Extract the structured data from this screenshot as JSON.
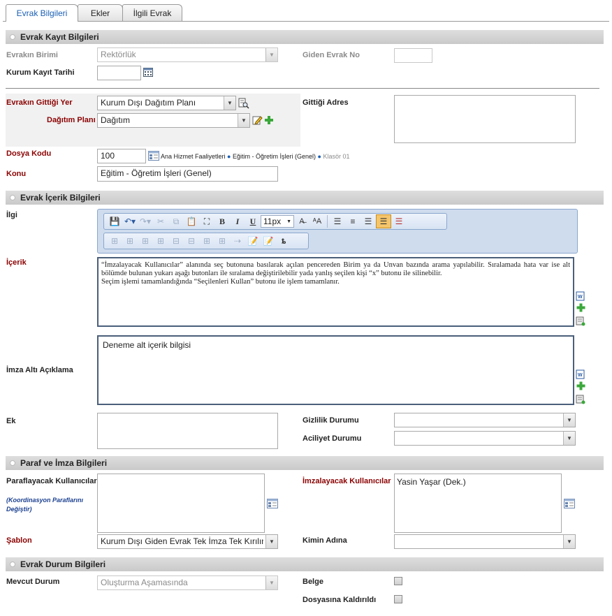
{
  "tabs": [
    "Evrak Bilgileri",
    "Ekler",
    "İlgili Evrak"
  ],
  "sections": {
    "kayit": "Evrak Kayıt Bilgileri",
    "icerik": "Evrak İçerik Bilgileri",
    "paraf": "Paraf ve İmza Bilgileri",
    "durum": "Evrak Durum Bilgileri"
  },
  "kayit": {
    "birim_label": "Evrakın Birimi",
    "birim_value": "Rektörlük",
    "giden_no_label": "Giden Evrak No",
    "giden_no_value": "",
    "tarih_label": "Kurum Kayıt Tarihi",
    "tarih_value": "",
    "gittigi_yer_label": "Evrakın Gittiği Yer",
    "gittigi_yer_value": "Kurum Dışı Dağıtım Planı",
    "dagitim_label": "Dağıtım Planı",
    "dagitim_value": "Dağıtım",
    "adres_label": "Gittiği Adres",
    "dosya_label": "Dosya Kodu",
    "dosya_value": "100",
    "crumb_1": "Ana Hizmet Faaliyetleri",
    "crumb_2": "Eğitim - Öğretim İşleri (Genel)",
    "crumb_3": "Klasör 01",
    "konu_label": "Konu",
    "konu_value": "Eğitim - Öğretim İşleri (Genel)"
  },
  "icerik": {
    "ilgi_label": "İlgi",
    "icerik_label": "İçerik",
    "font_size": "11px",
    "icerik_line1": "“İmzalayacak Kullanıcılar” alanında seç butonuna basılarak açılan pencereden Birim ya da Unvan bazında arama yapılabilir. Sıralamada hata var ise alt bölümde bulunan yukarı aşağı butonları ile sıralama değiştirilebilir yada yanlış seçilen kişi “x” butonu ile silinebilir.",
    "icerik_line2": "Seçim işlemi tamamlandığında “Seçilenleri Kullan” butonu ile işlem tamamlanır.",
    "imza_alti_label": "İmza Altı Açıklama",
    "imza_alti_value": "Deneme alt içerik bilgisi",
    "ek_label": "Ek",
    "gizlilik_label": "Gizlilik Durumu",
    "gizlilik_value": "",
    "aciliyet_label": "Aciliyet Durumu",
    "aciliyet_value": ""
  },
  "paraf": {
    "paraflayacak_label": "Paraflayacak Kullanıcılar",
    "koordinasyon_label": "(Koordinasyon Paraflarını Değiştir)",
    "imzalayacak_label": "İmzalayacak Kullanıcılar",
    "imzalayacak_value": "Yasin Yaşar (Dek.)",
    "sablon_label": "Şablon",
    "sablon_value": "Kurum Dışı Giden Evrak Tek İmza Tek Kırılım",
    "kimin_label": "Kimin Adına",
    "kimin_value": ""
  },
  "durum": {
    "mevcut_label": "Mevcut Durum",
    "mevcut_value": "Oluşturma Aşamasında",
    "belge_label": "Belge",
    "dosyasina_label": "Dosyasına Kaldırıldı"
  }
}
